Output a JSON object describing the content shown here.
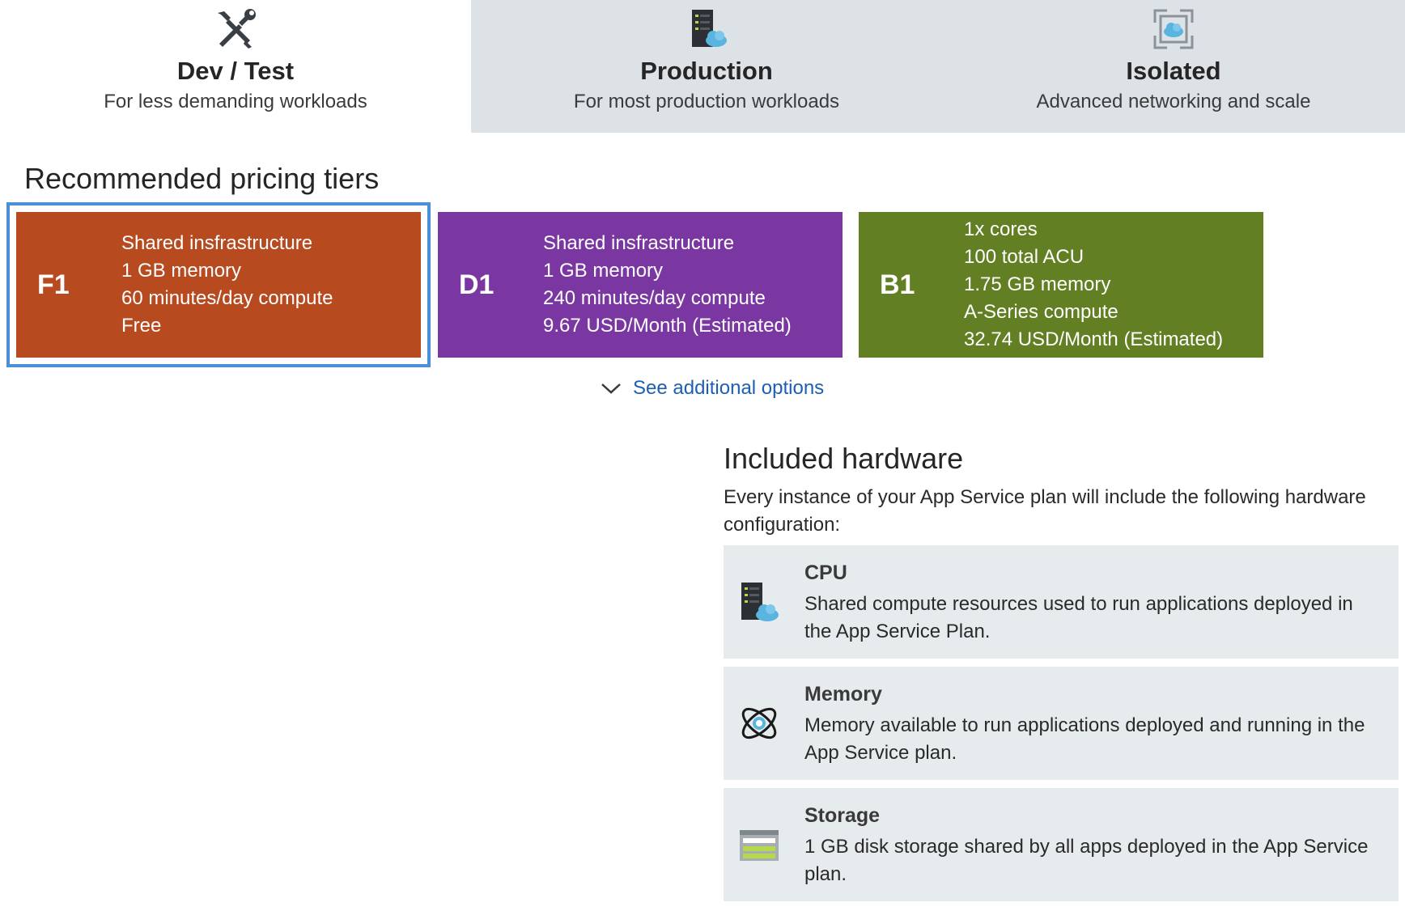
{
  "tabs": [
    {
      "title": "Dev / Test",
      "subtitle": "For less demanding workloads",
      "icon": "tools-icon",
      "selected": true
    },
    {
      "title": "Production",
      "subtitle": "For most production workloads",
      "icon": "server-cloud-icon",
      "selected": false
    },
    {
      "title": "Isolated",
      "subtitle": "Advanced networking and scale",
      "icon": "isolated-network-icon",
      "selected": false
    }
  ],
  "recommended_title": "Recommended pricing tiers",
  "tiers": [
    {
      "code": "F1",
      "color": "#b84a1f",
      "selected": true,
      "lines": [
        "Shared insfrastructure",
        "1 GB memory",
        "60 minutes/day compute",
        "Free"
      ]
    },
    {
      "code": "D1",
      "color": "#7a37a2",
      "selected": false,
      "lines": [
        "Shared insfrastructure",
        "1 GB memory",
        "240 minutes/day compute",
        "9.67 USD/Month (Estimated)"
      ]
    },
    {
      "code": "B1",
      "color": "#627f23",
      "selected": false,
      "lines": [
        "1x cores",
        "100 total ACU",
        "1.75 GB memory",
        "A-Series compute",
        "32.74 USD/Month (Estimated)"
      ]
    }
  ],
  "see_more": {
    "label": "See additional options",
    "icon": "chevron-down-icon"
  },
  "hardware": {
    "title": "Included hardware",
    "description": "Every instance of your App Service plan will include the following hardware configuration:",
    "items": [
      {
        "name": "CPU",
        "icon": "server-cloud-icon",
        "text": "Shared compute resources used to run applications deployed in the App Service Plan."
      },
      {
        "name": "Memory",
        "icon": "memory-icon",
        "text": "Memory available to run applications deployed and running in the App Service plan."
      },
      {
        "name": "Storage",
        "icon": "storage-icon",
        "text": "1 GB disk storage shared by all apps deployed in the App Service plan."
      }
    ]
  },
  "colors": {
    "accent": "#4a90d9",
    "link": "#1d5fb3",
    "tab_inactive": "#dce2e6",
    "panel": "#e6ebee"
  }
}
